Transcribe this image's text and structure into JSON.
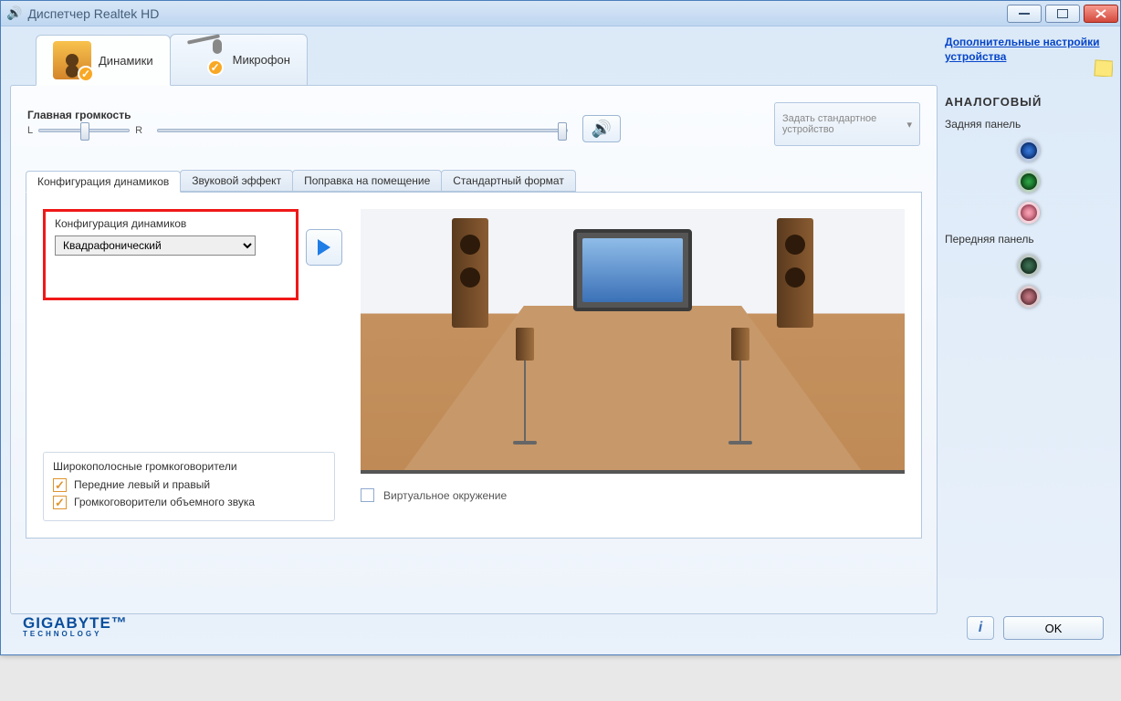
{
  "window": {
    "title": "Диспетчер Realtek HD"
  },
  "device_tabs": {
    "speakers": "Динамики",
    "mic": "Микрофон"
  },
  "volume": {
    "label": "Главная громкость",
    "left": "L",
    "right": "R",
    "default_device": "Задать стандартное устройство"
  },
  "sub_tabs": {
    "config": "Конфигурация динамиков",
    "effect": "Звуковой эффект",
    "room": "Поправка на помещение",
    "format": "Стандартный формат"
  },
  "config": {
    "label": "Конфигурация динамиков",
    "selected": "Квадрафонический"
  },
  "broadband": {
    "title": "Широкополосные громкоговорители",
    "front": "Передние левый и правый",
    "surround": "Громкоговорители объемного звука"
  },
  "virtual": "Виртуальное окружение",
  "right": {
    "advanced_link": "Дополнительные настройки устройства",
    "analog": "АНАЛОГОВЫЙ",
    "rear": "Задняя панель",
    "front": "Передняя панель"
  },
  "footer": {
    "brand": "GIGABYTE",
    "sub": "TECHNOLOGY"
  },
  "buttons": {
    "ok": "OK"
  }
}
